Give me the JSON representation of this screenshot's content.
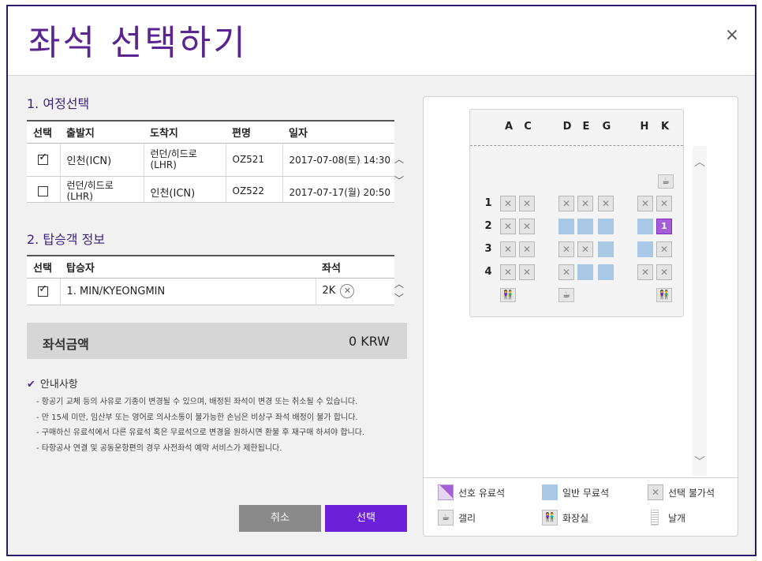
{
  "dialog": {
    "title": "좌석 선택하기",
    "close_glyph": "×"
  },
  "itinerary": {
    "heading": "1. 여정선택",
    "columns": [
      "선택",
      "출발지",
      "도착지",
      "편명",
      "일자"
    ],
    "rows": [
      {
        "checked": true,
        "origin": "인천(ICN)",
        "destination": "런던/히드로\n(LHR)",
        "flight": "OZ521",
        "date": "2017-07-08(토) 14:30"
      },
      {
        "checked": false,
        "origin": "런던/히드로\n(LHR)",
        "destination": "인천(ICN)",
        "flight": "OZ522",
        "date": "2017-07-17(월) 20:50"
      }
    ]
  },
  "passengers": {
    "heading": "2. 탑승객 정보",
    "columns": [
      "선택",
      "탑승자",
      "좌석"
    ],
    "rows": [
      {
        "checked": true,
        "name": "1. MIN/KYEONGMIN",
        "seat": "2K"
      }
    ]
  },
  "price": {
    "label": "좌석금액",
    "value": "0 KRW"
  },
  "notice": {
    "heading": "안내사항",
    "items": [
      "- 항공기 교체 등의 사유로 기종이 변경될 수 있으며, 배정된 좌석이 변경 또는 취소될 수 있습니다.",
      "- 만 15세 미만, 임산부 또는 영어로 의사소통이 불가능한 손님은 비상구 좌석 배정이 불가 합니다.",
      "- 구매하신 유료석에서 다른 유료석 혹은 무료석으로 변경을 원하시면 환불 후 재구매 하셔야 합니다.",
      "- 타항공사 연결 및 공동운항편의 경우 사전좌석 예약 서비스가 제한됩니다."
    ]
  },
  "buttons": {
    "cancel": "취소",
    "select": "선택"
  },
  "seatmap": {
    "columns": [
      "A",
      "C",
      "D",
      "E",
      "G",
      "H",
      "K"
    ],
    "rows": [
      {
        "num": "1",
        "seats": [
          "x",
          "x",
          "x",
          "x",
          "x",
          "x",
          "x"
        ]
      },
      {
        "num": "2",
        "seats": [
          "x",
          "x",
          "free",
          "free",
          "free",
          "free",
          "sel"
        ]
      },
      {
        "num": "3",
        "seats": [
          "x",
          "x",
          "x",
          "x",
          "free",
          "free",
          "x"
        ]
      },
      {
        "num": "4",
        "seats": [
          "x",
          "x",
          "x",
          "free",
          "free",
          "x",
          "x"
        ]
      }
    ],
    "selected_label": "1",
    "colors": {
      "free": "#a8c8e6",
      "selected": "#a45fd8",
      "blocked": "#e4e4e4"
    }
  },
  "legend": {
    "preferred_paid": "선호 유료석",
    "normal_free": "일반 무료석",
    "unavailable": "선택 불가석",
    "galley": "갤리",
    "lavatory": "화장실",
    "wing": "날개"
  }
}
